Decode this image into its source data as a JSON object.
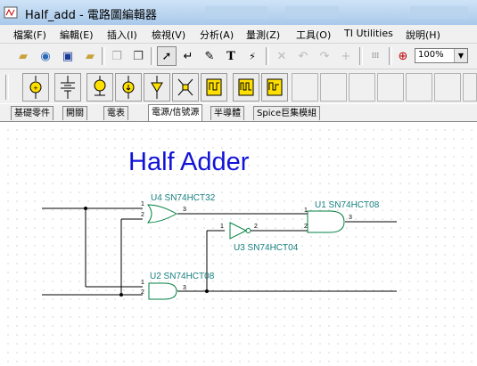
{
  "window": {
    "title": "Half_add - 電路圖編輯器"
  },
  "menu": [
    "檔案(F)",
    "編輯(E)",
    "插入(I)",
    "檢視(V)",
    "分析(A)",
    "量測(Z)",
    "工具(O)",
    "TI Utilities",
    "說明(H)"
  ],
  "toolbar": {
    "zoom_value": "100%"
  },
  "part_tabs": [
    "基礎零件",
    "開關",
    "電表",
    "電源/信號源",
    "半導體",
    "Spice巨集模組"
  ],
  "active_tab": "電源/信號源",
  "schematic": {
    "heading": "Half Adder",
    "components": [
      {
        "ref": "U4",
        "part": "SN74HCT32",
        "label": "U4 SN74HCT32"
      },
      {
        "ref": "U1",
        "part": "SN74HCT08",
        "label": "U1 SN74HCT08"
      },
      {
        "ref": "U3",
        "part": "SN74HCT04",
        "label": "U3 SN74HCT04"
      },
      {
        "ref": "U2",
        "part": "SN74HCT08",
        "label": "U2 SN74HCT08"
      }
    ],
    "pins": {
      "u4_in1": "1",
      "u4_in2": "2",
      "u4_out": "3",
      "u1_in1": "1",
      "u1_in2": "2",
      "u1_out": "3",
      "u3_in": "1",
      "u3_out": "2",
      "u2_in1": "1",
      "u2_in2": "2",
      "u2_out": "3"
    }
  },
  "colors": {
    "wire": "#000000",
    "gate": "#008040",
    "label": "#178080",
    "heading": "#1212d8"
  }
}
